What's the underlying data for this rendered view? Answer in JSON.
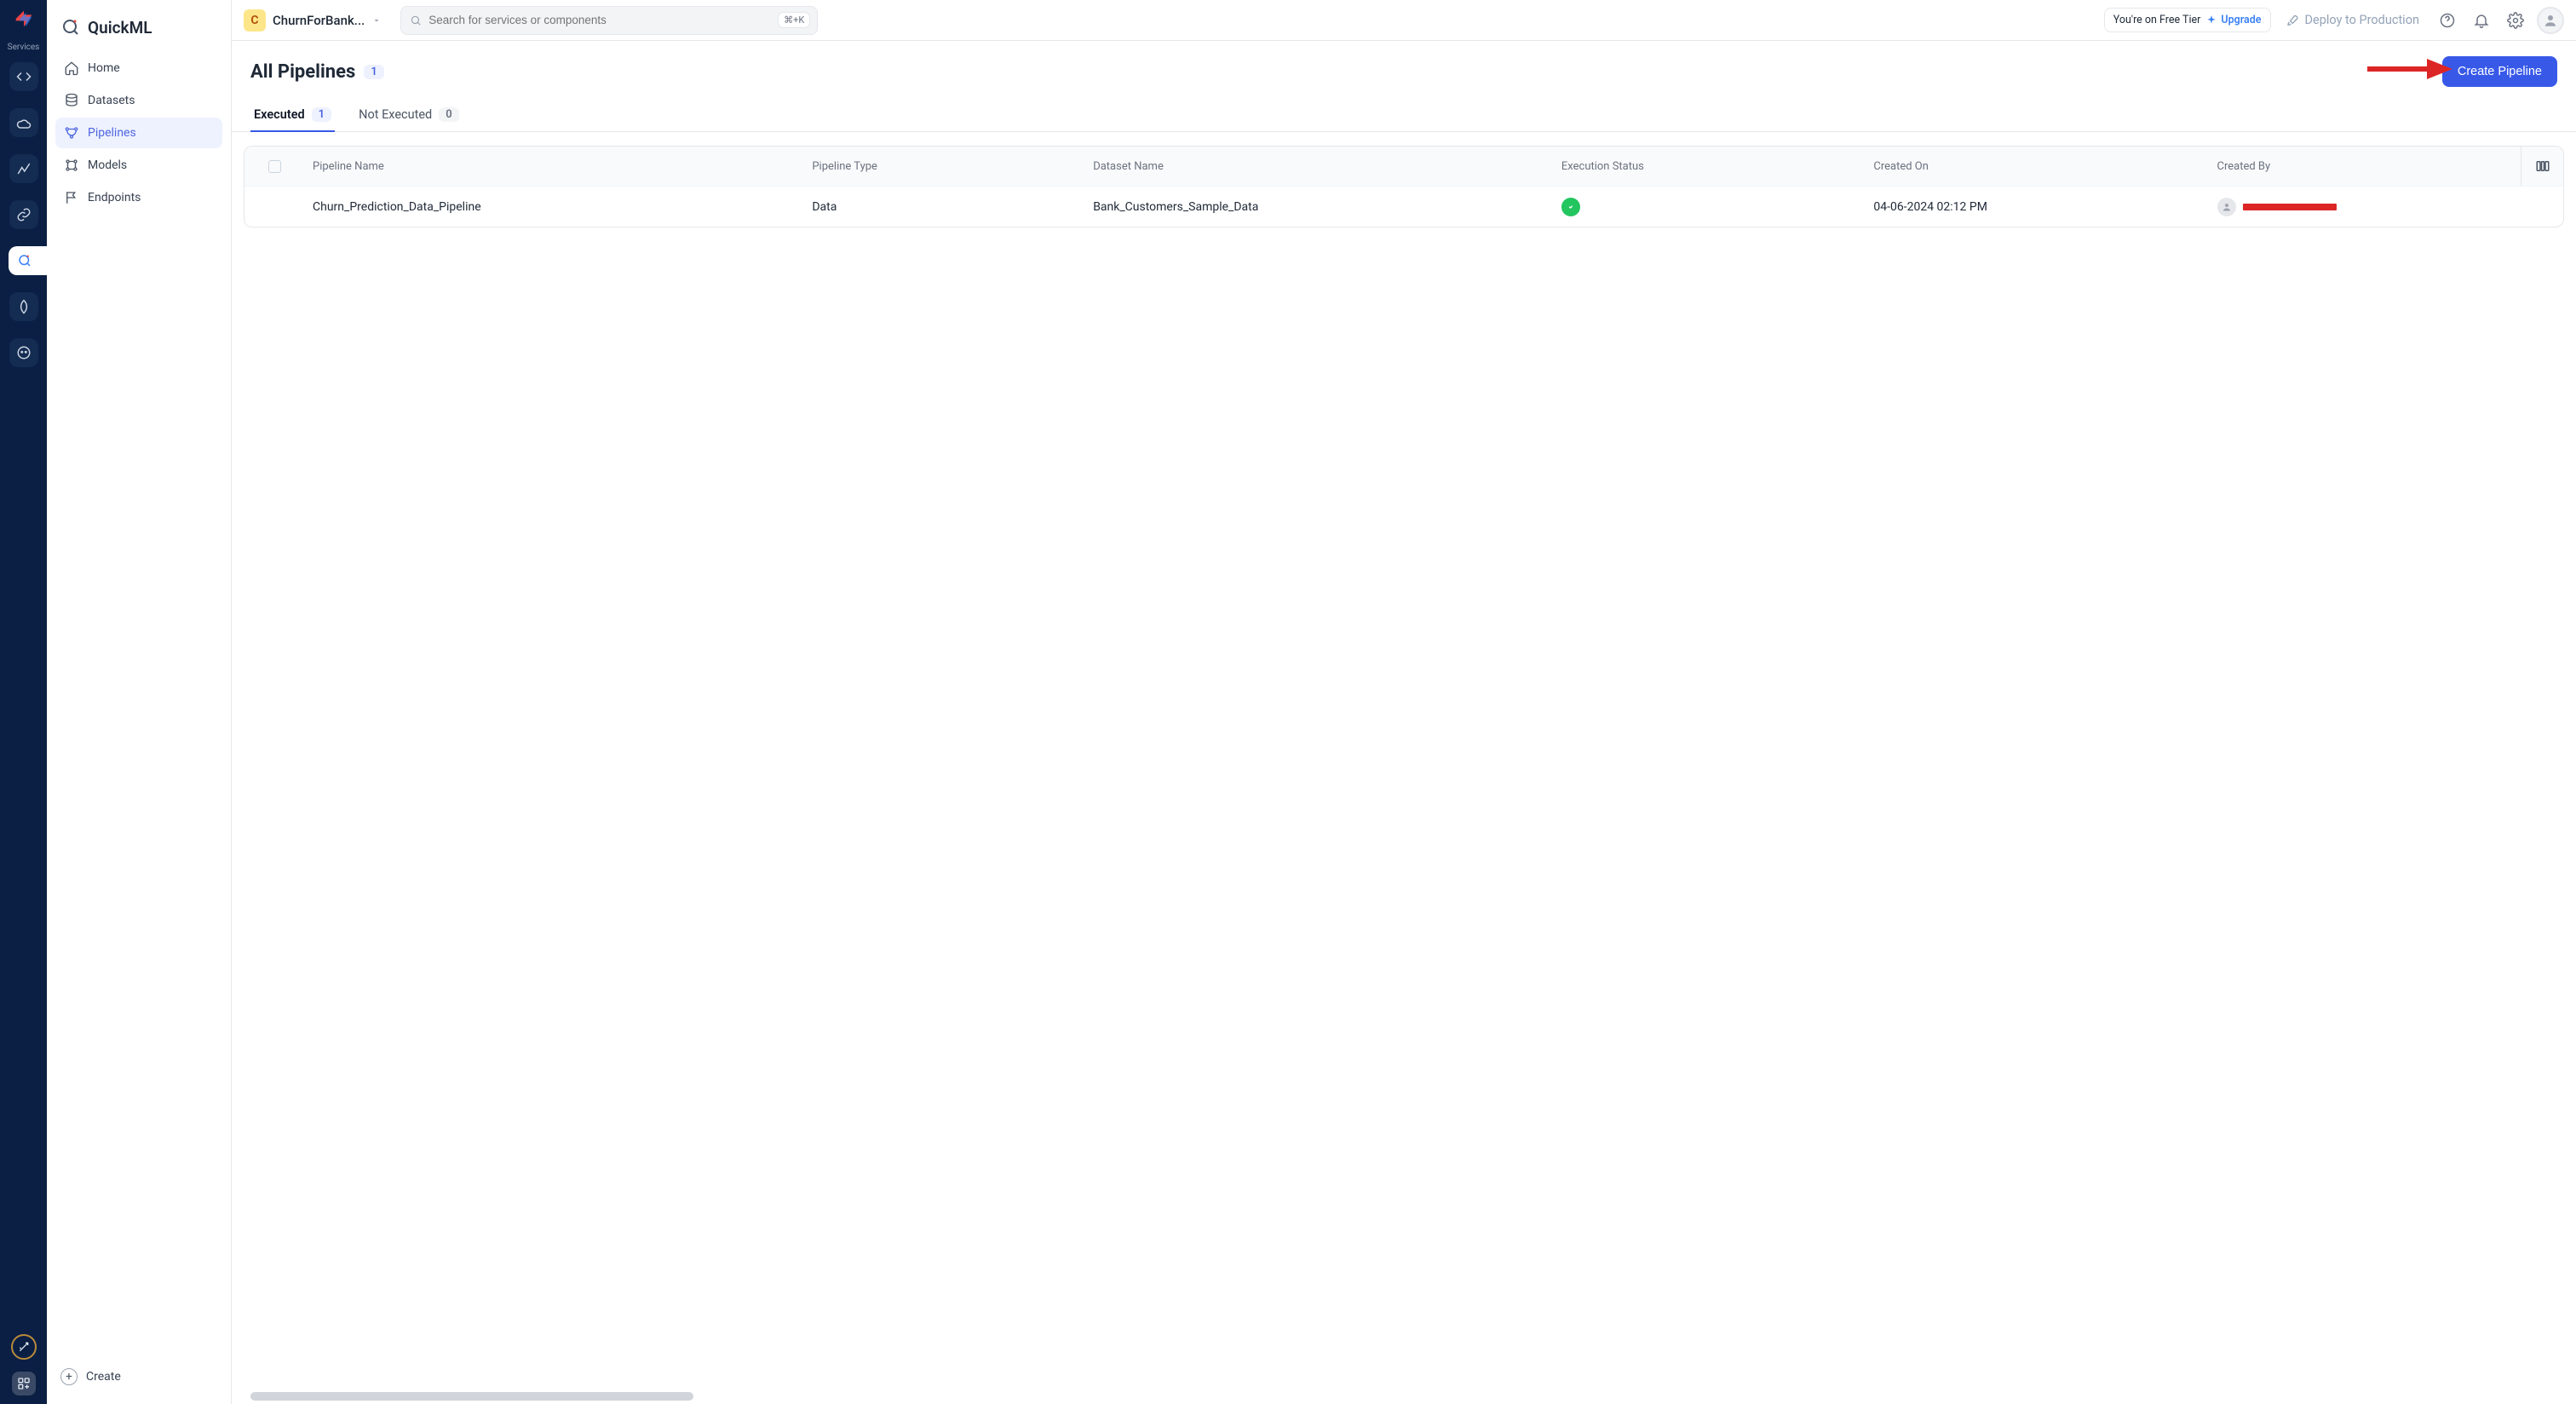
{
  "rail": {
    "services_label": "Services"
  },
  "topbar": {
    "project_letter": "C",
    "project_name": "ChurnForBank...",
    "search_placeholder": "Search for services or components",
    "search_shortcut": "⌘+K",
    "tier_text": "You're on Free Tier",
    "upgrade_label": "Upgrade",
    "deploy_label": "Deploy to Production"
  },
  "sidebar": {
    "brand": "QuickML",
    "items": [
      {
        "label": "Home"
      },
      {
        "label": "Datasets"
      },
      {
        "label": "Pipelines"
      },
      {
        "label": "Models"
      },
      {
        "label": "Endpoints"
      }
    ],
    "create_label": "Create"
  },
  "page": {
    "title": "All Pipelines",
    "total_count": "1",
    "create_button": "Create Pipeline"
  },
  "tabs": [
    {
      "label": "Executed",
      "count": "1",
      "active": true
    },
    {
      "label": "Not Executed",
      "count": "0",
      "active": false
    }
  ],
  "table": {
    "columns": {
      "pipeline_name": "Pipeline Name",
      "pipeline_type": "Pipeline Type",
      "dataset_name": "Dataset Name",
      "execution_status": "Execution Status",
      "created_on": "Created On",
      "created_by": "Created By"
    },
    "rows": [
      {
        "pipeline_name": "Churn_Prediction_Data_Pipeline",
        "pipeline_type": "Data",
        "dataset_name": "Bank_Customers_Sample_Data",
        "execution_status": "success",
        "created_on": "04-06-2024 02:12 PM",
        "created_by_redacted": true
      }
    ]
  }
}
